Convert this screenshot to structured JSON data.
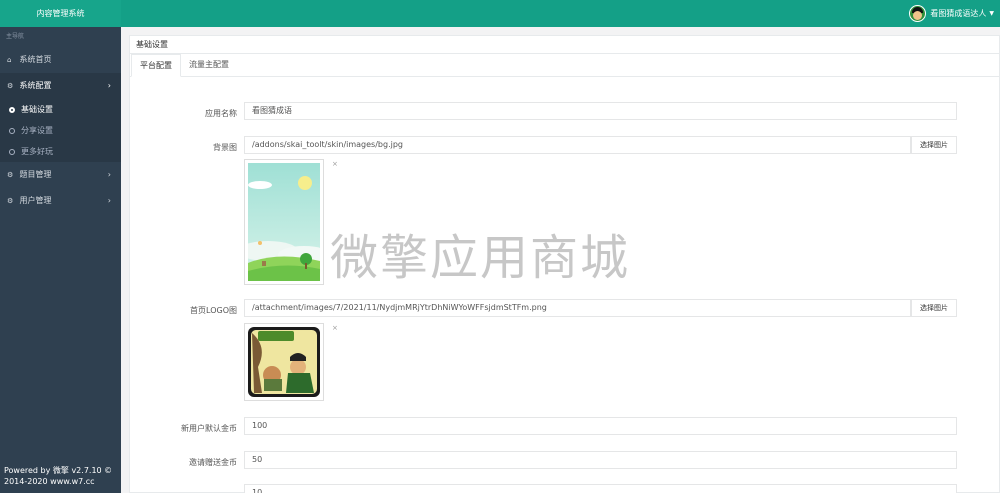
{
  "app": {
    "title": "内容管理系统"
  },
  "user": {
    "name": "看图猜成语达人"
  },
  "sidebar": {
    "heading": "主导航",
    "items": [
      {
        "label": "系统首页",
        "icon": "home-icon"
      },
      {
        "label": "系统配置",
        "icon": "gear-icon"
      },
      {
        "label": "题目管理",
        "icon": "gear-icon"
      },
      {
        "label": "用户管理",
        "icon": "gear-icon"
      }
    ],
    "subitems": [
      {
        "label": "基础设置"
      },
      {
        "label": "分享设置"
      },
      {
        "label": "更多好玩"
      }
    ],
    "footer": {
      "line1": "Powered by 微擎 v2.7.10 ©",
      "line2": "2014-2020 www.w7.cc"
    }
  },
  "main": {
    "title": "基础设置",
    "tabs": [
      {
        "label": "平台配置"
      },
      {
        "label": "流量主配置"
      }
    ],
    "fields": {
      "app_name": {
        "label": "应用名称",
        "value": "看图猜成语"
      },
      "background": {
        "label": "背景图",
        "value": "/addons/skai_toolt/skin/images/bg.jpg",
        "button": "选择图片"
      },
      "logo": {
        "label": "首页LOGO图",
        "value": "/attachment/images/7/2021/11/NydjmMRjYtrDhNiWYoWFFsjdmStTFm.png",
        "button": "选择图片"
      },
      "new_user_coins": {
        "label": "新用户默认金币",
        "value": "100"
      },
      "invite_coins": {
        "label": "邀请赠送金币",
        "value": "50"
      },
      "partial_value": "10"
    },
    "close_glyph": "×"
  },
  "watermark": "微擎应用商城",
  "colors": {
    "topbar": "#14a087",
    "sidebar": "#2f4050",
    "accent": "#1ab394"
  }
}
